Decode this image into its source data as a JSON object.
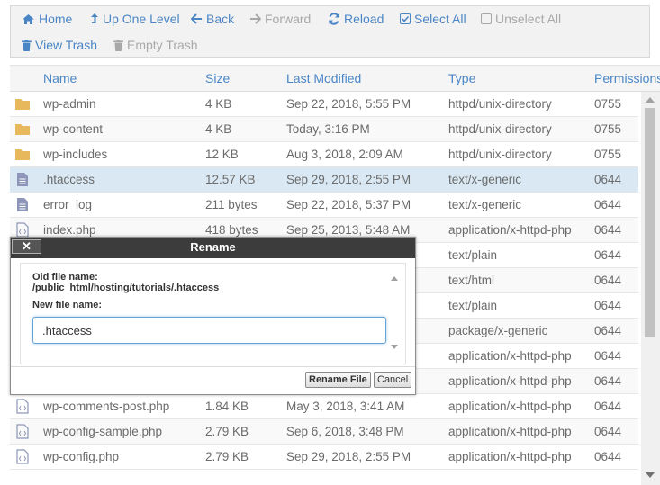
{
  "toolbar": {
    "home": "Home",
    "up_one_level": "Up One Level",
    "back": "Back",
    "forward": "Forward",
    "reload": "Reload",
    "select_all": "Select All",
    "unselect_all": "Unselect All",
    "view_trash": "View Trash",
    "empty_trash": "Empty Trash"
  },
  "table": {
    "headers": {
      "name": "Name",
      "size": "Size",
      "modified": "Last Modified",
      "type": "Type",
      "permissions": "Permissions"
    },
    "rows": [
      {
        "icon": "folder-icon",
        "name": "wp-admin",
        "size": "4 KB",
        "modified": "Sep 22, 2018, 5:55 PM",
        "type": "httpd/unix-directory",
        "perm": "0755"
      },
      {
        "icon": "folder-icon",
        "name": "wp-content",
        "size": "4 KB",
        "modified": "Today, 3:16 PM",
        "type": "httpd/unix-directory",
        "perm": "0755"
      },
      {
        "icon": "folder-icon",
        "name": "wp-includes",
        "size": "12 KB",
        "modified": "Aug 3, 2018, 2:09 AM",
        "type": "httpd/unix-directory",
        "perm": "0755"
      },
      {
        "icon": "text-file-icon",
        "name": ".htaccess",
        "size": "12.57 KB",
        "modified": "Sep 29, 2018, 2:55 PM",
        "type": "text/x-generic",
        "perm": "0644",
        "selected": true
      },
      {
        "icon": "text-file-icon",
        "name": "error_log",
        "size": "211 bytes",
        "modified": "Sep 22, 2018, 5:37 PM",
        "type": "text/x-generic",
        "perm": "0644"
      },
      {
        "icon": "php-file-icon",
        "name": "index.php",
        "size": "418 bytes",
        "modified": "Sep 25, 2013, 5:48 AM",
        "type": "application/x-httpd-php",
        "perm": "0644"
      },
      {
        "icon": "text-file-icon",
        "name": "",
        "size": "",
        "modified": "",
        "type": "text/plain",
        "perm": "0644"
      },
      {
        "icon": "code-file-icon",
        "name": "",
        "size": "",
        "modified": "",
        "type": "text/html",
        "perm": "0644"
      },
      {
        "icon": "text-file-icon",
        "name": "",
        "size": "",
        "modified": "",
        "type": "text/plain",
        "perm": "0644"
      },
      {
        "icon": "archive-file-icon",
        "name": "",
        "size": "",
        "modified": "",
        "type": "package/x-generic",
        "perm": "0644"
      },
      {
        "icon": "php-file-icon",
        "name": "",
        "size": "",
        "modified": "",
        "type": "application/x-httpd-php",
        "perm": "0644"
      },
      {
        "icon": "php-file-icon",
        "name": "",
        "size": "",
        "modified": "",
        "type": "application/x-httpd-php",
        "perm": "0644"
      },
      {
        "icon": "php-file-icon",
        "name": "wp-comments-post.php",
        "size": "1.84 KB",
        "modified": "May 3, 2018, 3:41 AM",
        "type": "application/x-httpd-php",
        "perm": "0644"
      },
      {
        "icon": "php-file-icon",
        "name": "wp-config-sample.php",
        "size": "2.79 KB",
        "modified": "Sep 6, 2018, 3:48 PM",
        "type": "application/x-httpd-php",
        "perm": "0644"
      },
      {
        "icon": "php-file-icon",
        "name": "wp-config.php",
        "size": "2.79 KB",
        "modified": "Sep 29, 2018, 2:55 PM",
        "type": "application/x-httpd-php",
        "perm": "0644"
      }
    ]
  },
  "dialog": {
    "title": "Rename",
    "close_label": "✕",
    "old_name_label": "Old file name:",
    "old_name_value": "/public_html/hosting/tutorials/.htaccess",
    "new_name_label": "New file name:",
    "new_name_value": ".htaccess",
    "rename_button": "Rename File",
    "cancel_button": "Cancel"
  },
  "colors": {
    "link": "#4a86c5",
    "disabled": "#a8a8a8",
    "selected_row": "#d9e8f2",
    "folder": "#e7b85c",
    "dialog_header": "#3c3c3c"
  }
}
